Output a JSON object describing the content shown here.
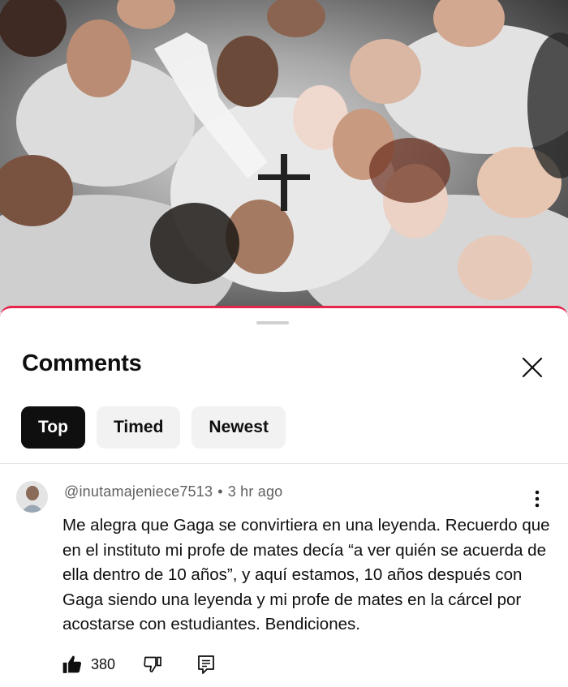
{
  "video": {
    "thumbnail_description_icon": "crowd-photo"
  },
  "comments_panel": {
    "title": "Comments",
    "close_icon": "close-icon",
    "filters": [
      {
        "label": "Top",
        "active": true
      },
      {
        "label": "Timed",
        "active": false
      },
      {
        "label": "Newest",
        "active": false
      }
    ]
  },
  "comment": {
    "author": "@inutamajeniece7513",
    "separator": "•",
    "time": "3 hr ago",
    "text": "Me alegra que Gaga se convirtiera en una leyenda. Recuerdo que en el instituto mi profe de mates decía “a ver quién se acuerda de ella dentro de 10 años”, y aquí estamos, 10 años después con Gaga siendo una leyenda y mi profe de mates en la cárcel por acostarse con estudiantes. Bendiciones.",
    "likes": "380",
    "icons": {
      "like": "thumbs-up-icon",
      "dislike": "thumbs-down-icon",
      "reply": "reply-icon",
      "more": "more-vert-icon"
    }
  },
  "colors": {
    "accent_line": "#e7244a",
    "chip_active_bg": "#0f0f0f",
    "chip_bg": "#f2f2f2",
    "meta_text": "#606060"
  }
}
